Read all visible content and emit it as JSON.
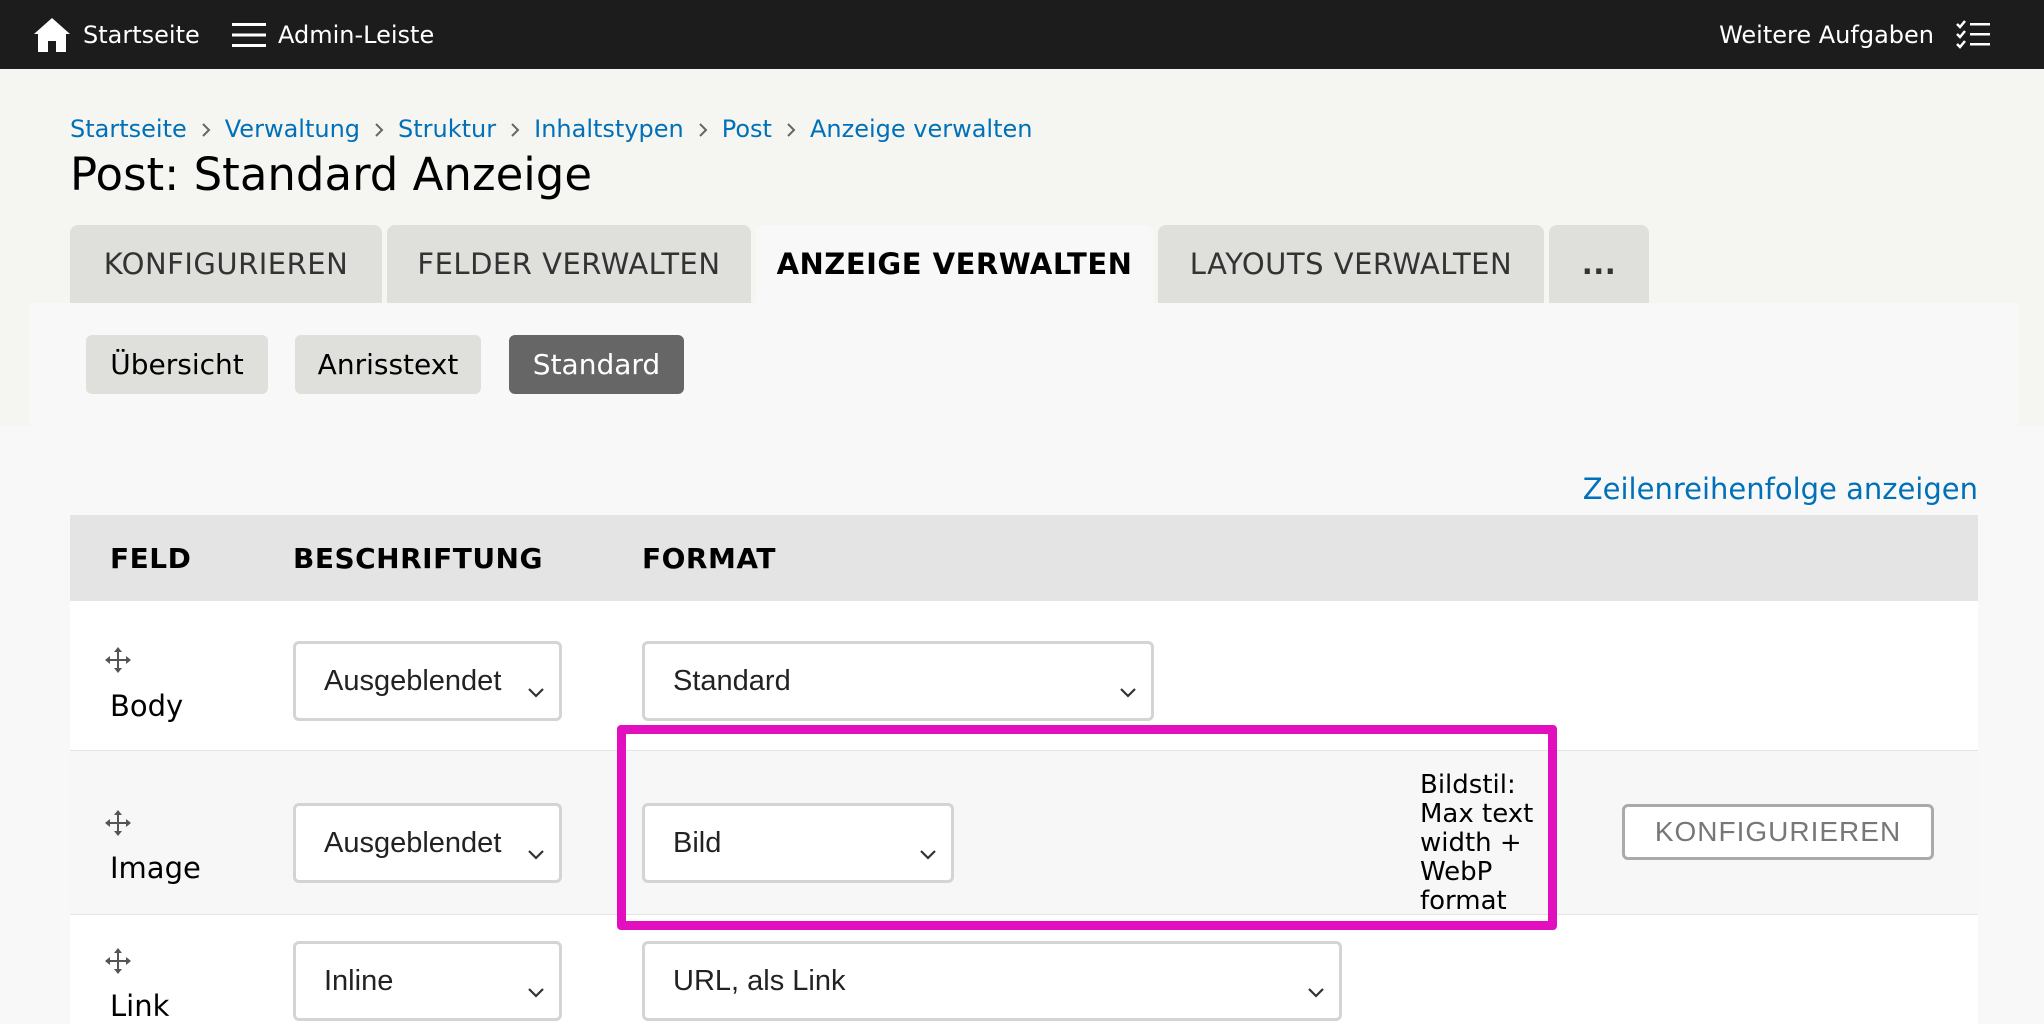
{
  "toolbar": {
    "home_label": "Startseite",
    "admin_label": "Admin-Leiste",
    "tasks_label": "Weitere Aufgaben"
  },
  "breadcrumb": [
    "Startseite",
    "Verwaltung",
    "Struktur",
    "Inhaltstypen",
    "Post",
    "Anzeige verwalten"
  ],
  "page": {
    "title": "Post: Standard Anzeige"
  },
  "tabs": [
    {
      "label": "KONFIGURIEREN"
    },
    {
      "label": "FELDER VERWALTEN"
    },
    {
      "label": "ANZEIGE VERWALTEN",
      "active": true
    },
    {
      "label": "LAYOUTS VERWALTEN"
    },
    {
      "label": "..."
    }
  ],
  "subtabs": [
    {
      "label": "Übersicht"
    },
    {
      "label": "Anrisstext"
    },
    {
      "label": "Standard",
      "active": true
    }
  ],
  "row_order_link": "Zeilenreihenfolge anzeigen",
  "table": {
    "headers": {
      "field": "FELD",
      "label": "BESCHRIFTUNG",
      "format": "FORMAT"
    },
    "rows": [
      {
        "field": "Body",
        "label": "Ausgeblendet",
        "format": "Standard"
      },
      {
        "field": "Image",
        "label": "Ausgeblendet",
        "format": "Bild",
        "summary": "Bildstil: Max text width + WebP format",
        "button": "KONFIGURIEREN"
      },
      {
        "field": "Link",
        "label": "Inline",
        "format": "URL, als Link"
      }
    ]
  },
  "colors": {
    "link": "#0071b8",
    "highlight": "#e20fbf",
    "toolbar": "#1c1c1c"
  },
  "icons": {
    "home": "home-icon",
    "menu": "hamburger-icon",
    "tasks": "checklist-icon",
    "drag": "move-handle-icon",
    "chevron": "chevron-down-icon"
  }
}
